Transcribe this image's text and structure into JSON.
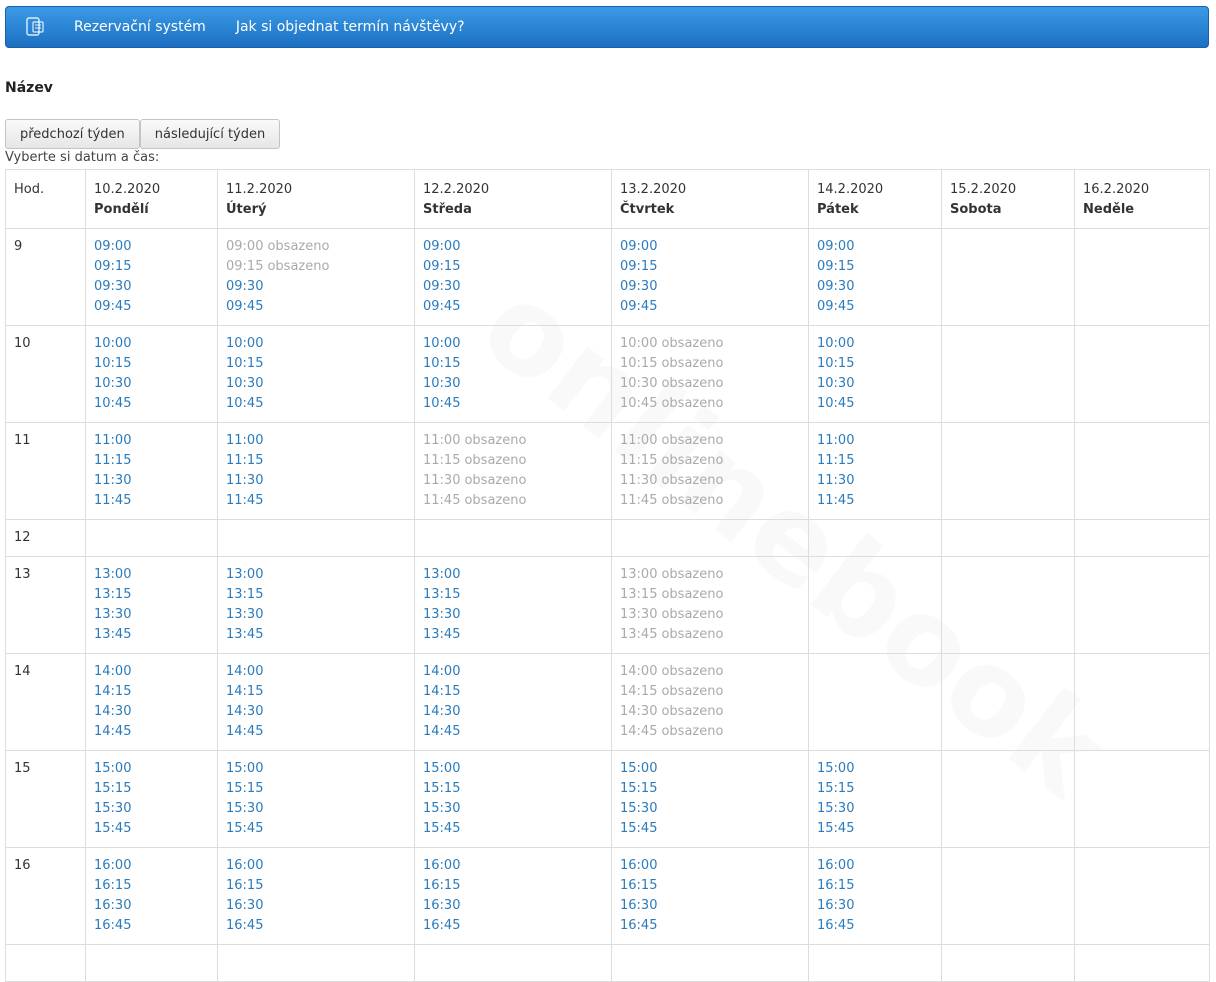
{
  "navbar": {
    "icon": "calendar-phone-icon",
    "links": [
      "Rezervační systém",
      "Jak si objednat termín návštěvy?"
    ]
  },
  "page_title": "Název",
  "buttons": {
    "prev_week": "předchozí týden",
    "next_week": "následující týden"
  },
  "hint": "Vyberte si datum a čas:",
  "table": {
    "hour_header": "Hod.",
    "days": [
      {
        "date": "10.2.2020",
        "name": "Pondělí"
      },
      {
        "date": "11.2.2020",
        "name": "Úterý"
      },
      {
        "date": "12.2.2020",
        "name": "Středa"
      },
      {
        "date": "13.2.2020",
        "name": "Čtvrtek"
      },
      {
        "date": "14.2.2020",
        "name": "Pátek"
      },
      {
        "date": "15.2.2020",
        "name": "Sobota"
      },
      {
        "date": "16.2.2020",
        "name": "Neděle"
      }
    ],
    "busy_label": "obsazeno",
    "rows": [
      {
        "hour": "9",
        "cells": [
          [
            {
              "t": "09:00"
            },
            {
              "t": "09:15"
            },
            {
              "t": "09:30"
            },
            {
              "t": "09:45"
            }
          ],
          [
            {
              "t": "09:00",
              "busy": true
            },
            {
              "t": "09:15",
              "busy": true
            },
            {
              "t": "09:30"
            },
            {
              "t": "09:45"
            }
          ],
          [
            {
              "t": "09:00"
            },
            {
              "t": "09:15"
            },
            {
              "t": "09:30"
            },
            {
              "t": "09:45"
            }
          ],
          [
            {
              "t": "09:00"
            },
            {
              "t": "09:15"
            },
            {
              "t": "09:30"
            },
            {
              "t": "09:45"
            }
          ],
          [
            {
              "t": "09:00"
            },
            {
              "t": "09:15"
            },
            {
              "t": "09:30"
            },
            {
              "t": "09:45"
            }
          ],
          [],
          []
        ]
      },
      {
        "hour": "10",
        "cells": [
          [
            {
              "t": "10:00"
            },
            {
              "t": "10:15"
            },
            {
              "t": "10:30"
            },
            {
              "t": "10:45"
            }
          ],
          [
            {
              "t": "10:00"
            },
            {
              "t": "10:15"
            },
            {
              "t": "10:30"
            },
            {
              "t": "10:45"
            }
          ],
          [
            {
              "t": "10:00"
            },
            {
              "t": "10:15"
            },
            {
              "t": "10:30"
            },
            {
              "t": "10:45"
            }
          ],
          [
            {
              "t": "10:00",
              "busy": true
            },
            {
              "t": "10:15",
              "busy": true
            },
            {
              "t": "10:30",
              "busy": true
            },
            {
              "t": "10:45",
              "busy": true
            }
          ],
          [
            {
              "t": "10:00"
            },
            {
              "t": "10:15"
            },
            {
              "t": "10:30"
            },
            {
              "t": "10:45"
            }
          ],
          [],
          []
        ]
      },
      {
        "hour": "11",
        "cells": [
          [
            {
              "t": "11:00"
            },
            {
              "t": "11:15"
            },
            {
              "t": "11:30"
            },
            {
              "t": "11:45"
            }
          ],
          [
            {
              "t": "11:00"
            },
            {
              "t": "11:15"
            },
            {
              "t": "11:30"
            },
            {
              "t": "11:45"
            }
          ],
          [
            {
              "t": "11:00",
              "busy": true
            },
            {
              "t": "11:15",
              "busy": true
            },
            {
              "t": "11:30",
              "busy": true
            },
            {
              "t": "11:45",
              "busy": true
            }
          ],
          [
            {
              "t": "11:00",
              "busy": true
            },
            {
              "t": "11:15",
              "busy": true
            },
            {
              "t": "11:30",
              "busy": true
            },
            {
              "t": "11:45",
              "busy": true
            }
          ],
          [
            {
              "t": "11:00"
            },
            {
              "t": "11:15"
            },
            {
              "t": "11:30"
            },
            {
              "t": "11:45"
            }
          ],
          [],
          []
        ]
      },
      {
        "hour": "12",
        "cells": [
          [],
          [],
          [],
          [],
          [],
          [],
          []
        ]
      },
      {
        "hour": "13",
        "cells": [
          [
            {
              "t": "13:00"
            },
            {
              "t": "13:15"
            },
            {
              "t": "13:30"
            },
            {
              "t": "13:45"
            }
          ],
          [
            {
              "t": "13:00"
            },
            {
              "t": "13:15"
            },
            {
              "t": "13:30"
            },
            {
              "t": "13:45"
            }
          ],
          [
            {
              "t": "13:00"
            },
            {
              "t": "13:15"
            },
            {
              "t": "13:30"
            },
            {
              "t": "13:45"
            }
          ],
          [
            {
              "t": "13:00",
              "busy": true
            },
            {
              "t": "13:15",
              "busy": true
            },
            {
              "t": "13:30",
              "busy": true
            },
            {
              "t": "13:45",
              "busy": true
            }
          ],
          [],
          [],
          []
        ]
      },
      {
        "hour": "14",
        "cells": [
          [
            {
              "t": "14:00"
            },
            {
              "t": "14:15"
            },
            {
              "t": "14:30"
            },
            {
              "t": "14:45"
            }
          ],
          [
            {
              "t": "14:00"
            },
            {
              "t": "14:15"
            },
            {
              "t": "14:30"
            },
            {
              "t": "14:45"
            }
          ],
          [
            {
              "t": "14:00"
            },
            {
              "t": "14:15"
            },
            {
              "t": "14:30"
            },
            {
              "t": "14:45"
            }
          ],
          [
            {
              "t": "14:00",
              "busy": true
            },
            {
              "t": "14:15",
              "busy": true
            },
            {
              "t": "14:30",
              "busy": true
            },
            {
              "t": "14:45",
              "busy": true
            }
          ],
          [],
          [],
          []
        ]
      },
      {
        "hour": "15",
        "cells": [
          [
            {
              "t": "15:00"
            },
            {
              "t": "15:15"
            },
            {
              "t": "15:30"
            },
            {
              "t": "15:45"
            }
          ],
          [
            {
              "t": "15:00"
            },
            {
              "t": "15:15"
            },
            {
              "t": "15:30"
            },
            {
              "t": "15:45"
            }
          ],
          [
            {
              "t": "15:00"
            },
            {
              "t": "15:15"
            },
            {
              "t": "15:30"
            },
            {
              "t": "15:45"
            }
          ],
          [
            {
              "t": "15:00"
            },
            {
              "t": "15:15"
            },
            {
              "t": "15:30"
            },
            {
              "t": "15:45"
            }
          ],
          [
            {
              "t": "15:00"
            },
            {
              "t": "15:15"
            },
            {
              "t": "15:30"
            },
            {
              "t": "15:45"
            }
          ],
          [],
          []
        ]
      },
      {
        "hour": "16",
        "cells": [
          [
            {
              "t": "16:00"
            },
            {
              "t": "16:15"
            },
            {
              "t": "16:30"
            },
            {
              "t": "16:45"
            }
          ],
          [
            {
              "t": "16:00"
            },
            {
              "t": "16:15"
            },
            {
              "t": "16:30"
            },
            {
              "t": "16:45"
            }
          ],
          [
            {
              "t": "16:00"
            },
            {
              "t": "16:15"
            },
            {
              "t": "16:30"
            },
            {
              "t": "16:45"
            }
          ],
          [
            {
              "t": "16:00"
            },
            {
              "t": "16:15"
            },
            {
              "t": "16:30"
            },
            {
              "t": "16:45"
            }
          ],
          [
            {
              "t": "16:00"
            },
            {
              "t": "16:15"
            },
            {
              "t": "16:30"
            },
            {
              "t": "16:45"
            }
          ],
          [],
          []
        ]
      },
      {
        "hour": "",
        "cells": [
          [],
          [],
          [],
          [],
          [],
          [],
          []
        ]
      }
    ]
  },
  "watermark": "onlinebook"
}
